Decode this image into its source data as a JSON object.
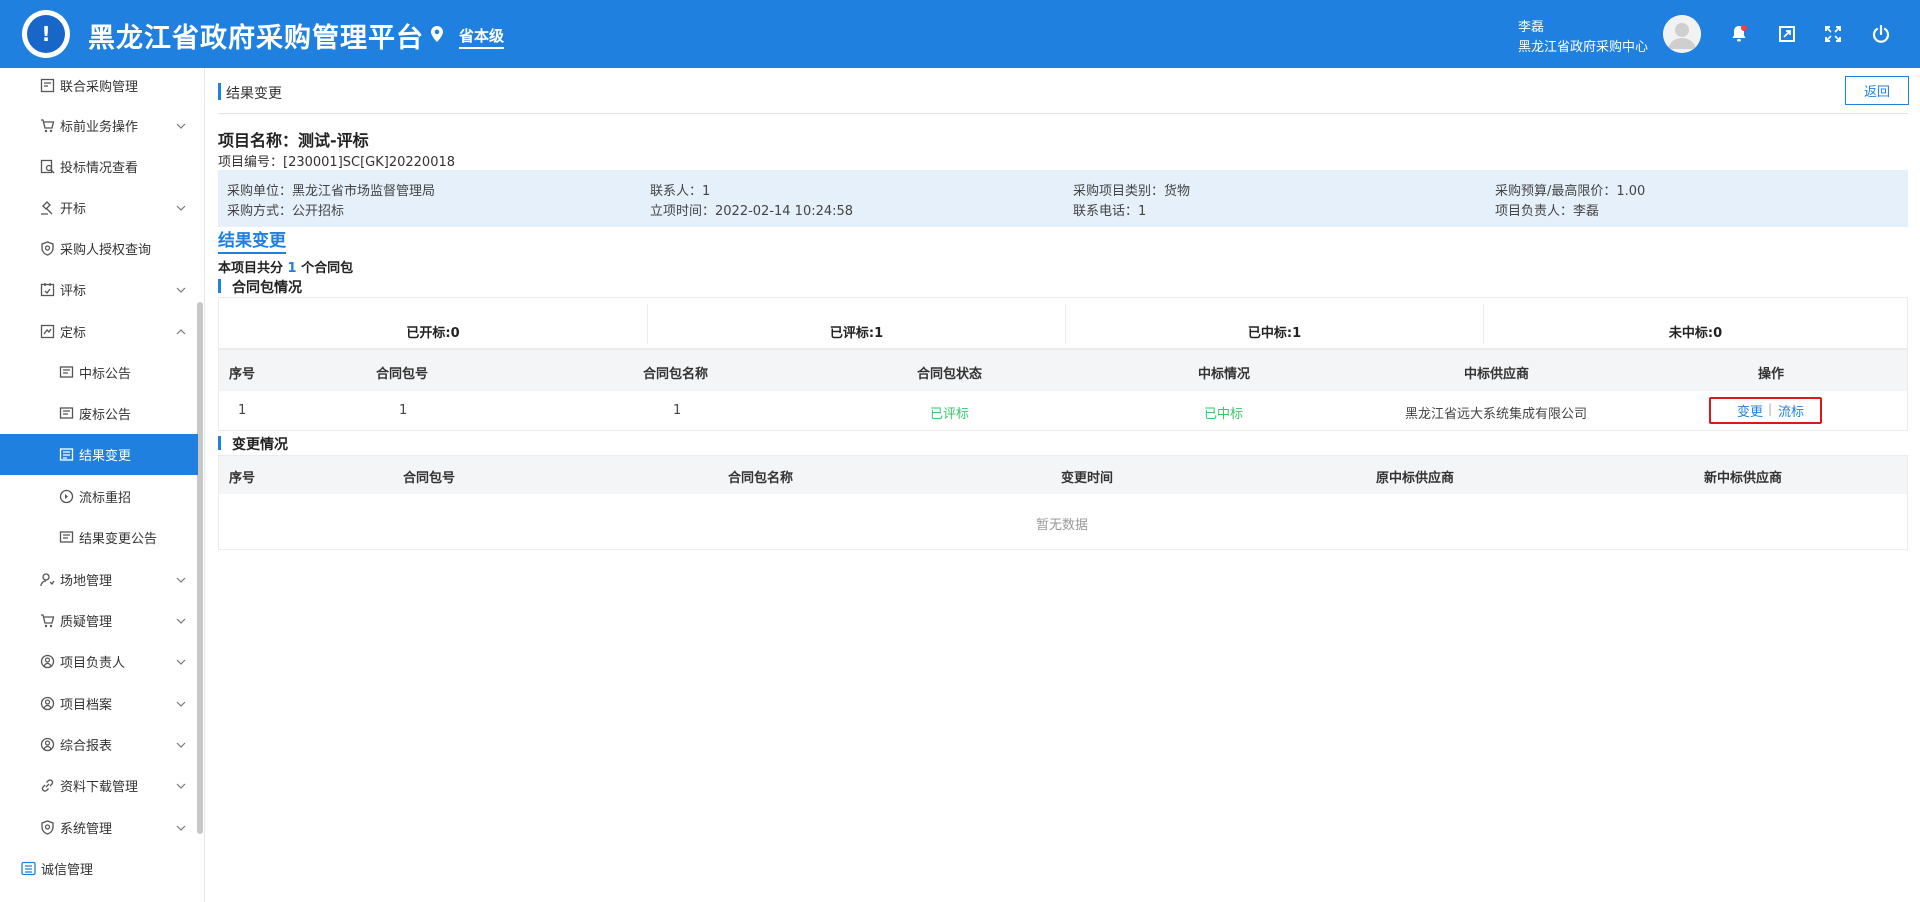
{
  "header": {
    "logo_glyph": "!",
    "app_title": "黑龙江省政府采购管理平台",
    "location_label": "省本级",
    "user_name": "李磊",
    "user_org": "黑龙江省政府采购中心",
    "icons": [
      "location-pin-icon",
      "bell-icon",
      "window-icon",
      "fullscreen-icon",
      "power-icon"
    ],
    "accent": "#1f80e0",
    "notification_dot": "#ff3b3b"
  },
  "sidebar": {
    "items": [
      {
        "label": "联合采购管理",
        "icon": "joint-purchase-icon",
        "has_children": false
      },
      {
        "label": "标前业务操作",
        "icon": "cart-icon",
        "has_children": true
      },
      {
        "label": "投标情况查看",
        "icon": "doc-search-icon",
        "has_children": false
      },
      {
        "label": "开标",
        "icon": "gavel-icon",
        "has_children": true
      },
      {
        "label": "采购人授权查询",
        "icon": "shield-search-icon",
        "has_children": false
      },
      {
        "label": "评标",
        "icon": "evaluate-icon",
        "has_children": true
      },
      {
        "label": "定标",
        "icon": "award-icon",
        "has_children": true,
        "expanded": true
      },
      {
        "label": "中标公告",
        "icon": "notice-icon",
        "sub": true
      },
      {
        "label": "废标公告",
        "icon": "notice-icon",
        "sub": true
      },
      {
        "label": "结果变更",
        "icon": "change-icon",
        "sub": true,
        "active": true
      },
      {
        "label": "流标重招",
        "icon": "retender-icon",
        "sub": true
      },
      {
        "label": "结果变更公告",
        "icon": "notice-icon",
        "sub": true
      },
      {
        "label": "场地管理",
        "icon": "venue-icon",
        "has_children": true
      },
      {
        "label": "质疑管理",
        "icon": "cart-icon",
        "has_children": true
      },
      {
        "label": "项目负责人",
        "icon": "user-circle-icon",
        "has_children": true
      },
      {
        "label": "项目档案",
        "icon": "user-circle-icon",
        "has_children": true
      },
      {
        "label": "综合报表",
        "icon": "user-circle-icon",
        "has_children": true
      },
      {
        "label": "资料下载管理",
        "icon": "link-icon",
        "has_children": true
      },
      {
        "label": "系统管理",
        "icon": "shield-icon",
        "has_children": true
      },
      {
        "label": "诚信管理",
        "icon": "list-icon",
        "has_children": false,
        "top_level": true
      }
    ]
  },
  "page": {
    "title": "结果变更",
    "back_label": "返回"
  },
  "project": {
    "name_label": "项目名称：测试-评标",
    "code_label": "项目编号：[230001]SC[GK]20220018",
    "info": [
      {
        "text": "采购单位：黑龙江省市场监督管理局"
      },
      {
        "text": "联系人：1"
      },
      {
        "text": "采购项目类别：货物"
      },
      {
        "text": "采购预算/最高限价：1.00"
      },
      {
        "text": "采购方式：公开招标"
      },
      {
        "text": "立项时间：2022-02-14 10:24:58"
      },
      {
        "text": "联系电话：1"
      },
      {
        "text": "项目负责人：李磊"
      }
    ]
  },
  "result": {
    "section_title": "结果变更",
    "count_prefix": "本项目共分",
    "count_num": "1",
    "count_suffix": "个合同包"
  },
  "package_section": {
    "title": "合同包情况",
    "stats": [
      "已开标:0",
      "已评标:1",
      "已中标:1",
      "未中标:0"
    ],
    "headers": [
      "序号",
      "合同包号",
      "合同包名称",
      "合同包状态",
      "中标情况",
      "中标供应商",
      "操作"
    ],
    "rows": [
      {
        "seq": "1",
        "pkg_no": "1",
        "pkg_name": "1",
        "status": "已评标",
        "win": "已中标",
        "supplier": "黑龙江省远大系统集成有限公司"
      }
    ],
    "actions": {
      "change": "变更",
      "sep": "|",
      "fail": "流标"
    },
    "status_color": "#3cc66a",
    "highlight_color": "#e0161b"
  },
  "change_section": {
    "title": "变更情况",
    "headers": [
      "序号",
      "合同包号",
      "合同包名称",
      "变更时间",
      "原中标供应商",
      "新中标供应商"
    ],
    "empty_text": "暂无数据"
  }
}
